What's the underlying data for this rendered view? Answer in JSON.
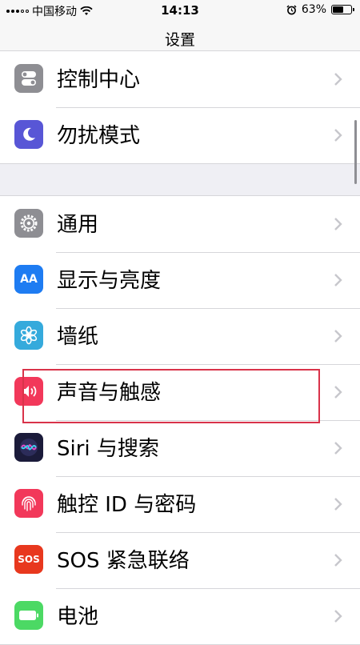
{
  "status_bar": {
    "carrier": "中国移动",
    "time": "14:13",
    "battery_percent_label": "63%",
    "battery_level": 0.63
  },
  "nav": {
    "title": "设置"
  },
  "group1": [
    {
      "label": "控制中心",
      "icon": "control-center-icon",
      "color": "#8e8e93"
    },
    {
      "label": "勿扰模式",
      "icon": "moon-icon",
      "color": "#5856d6"
    }
  ],
  "group2": [
    {
      "label": "通用",
      "icon": "gear-icon",
      "color": "#8e8e93"
    },
    {
      "label": "显示与亮度",
      "icon": "display-aa-icon",
      "icon_text": "AA",
      "color": "#1e7cf2"
    },
    {
      "label": "墙纸",
      "icon": "wallpaper-flower-icon",
      "color": "#35aadc"
    },
    {
      "label": "声音与触感",
      "icon": "sound-speaker-icon",
      "color": "#f2385a"
    },
    {
      "label": "Siri 与搜索",
      "icon": "siri-icon",
      "color": "#1b1b3a"
    },
    {
      "label": "触控 ID 与密码",
      "icon": "fingerprint-icon",
      "color": "#f2385a"
    },
    {
      "label": "SOS 紧急联络",
      "icon": "sos-icon",
      "icon_text": "SOS",
      "color": "#e8381e"
    },
    {
      "label": "电池",
      "icon": "battery-icon",
      "color": "#4cd964"
    }
  ]
}
